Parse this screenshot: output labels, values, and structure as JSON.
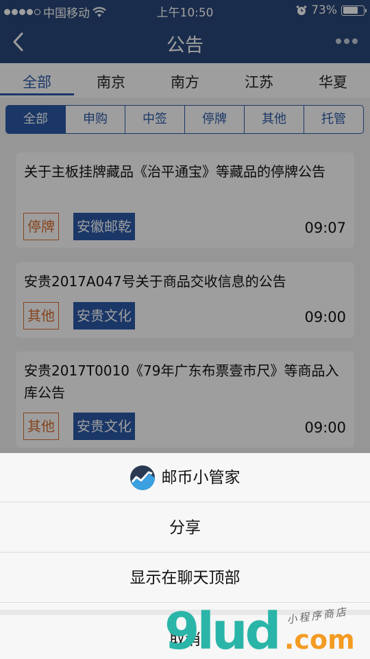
{
  "status": {
    "carrier": "中国移动",
    "time": "上午10:50",
    "battery": "73%",
    "battery_level": 0.73
  },
  "nav": {
    "title": "公告",
    "back_icon": "chevron-left-icon",
    "more_icon": "more-dots-icon"
  },
  "regions": {
    "active_index": 0,
    "items": [
      "全部",
      "南京",
      "南方",
      "江苏",
      "华夏"
    ]
  },
  "filters": {
    "active_index": 0,
    "items": [
      "全部",
      "申购",
      "中签",
      "停牌",
      "其他",
      "托管"
    ]
  },
  "notices": [
    {
      "title": "关于主板挂牌藏品《治平通宝》等藏品的停牌公告",
      "tag": "停牌",
      "org": "安徽邮乾",
      "time": "09:07"
    },
    {
      "title": "安贵2017A047号关于商品交收信息的公告",
      "tag": "其他",
      "org": "安贵文化",
      "time": "09:00"
    },
    {
      "title": "安贵2017T0010《79年广东布票壹市尺》等商品入库公告",
      "tag": "其他",
      "org": "安贵文化",
      "time": "09:00"
    }
  ],
  "sheet": {
    "app_name": "邮币小管家",
    "share": "分享",
    "pin_top": "显示在聊天顶部",
    "cancel": "取消"
  },
  "watermark": {
    "brand": "9lud",
    "domain": ".com",
    "tagline": "小程序商店"
  },
  "colors": {
    "primary": "#2a477a",
    "accent": "#2a5aa8",
    "tag": "#d86c2c"
  }
}
